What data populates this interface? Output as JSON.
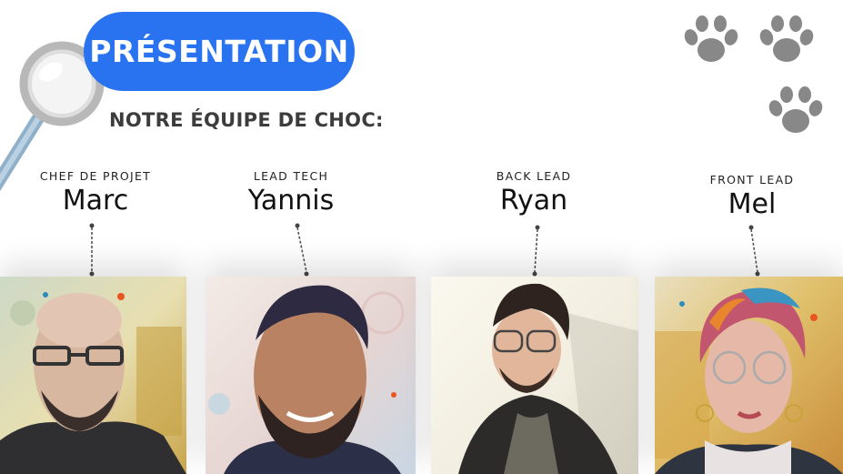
{
  "slide": {
    "title": "PRÉSENTATION",
    "subtitle": "NOTRE ÉQUIPE DE CHOC:"
  },
  "team": [
    {
      "role": "CHEF DE PROJET",
      "name": "Marc"
    },
    {
      "role": "LEAD TECH",
      "name": "Yannis"
    },
    {
      "role": "BACK LEAD",
      "name": "Ryan"
    },
    {
      "role": "FRONT LEAD",
      "name": "Mel"
    }
  ],
  "colors": {
    "accent": "#2a73f0",
    "paw": "#888888",
    "text_dark": "#3c3c3c"
  },
  "icons": [
    "magnifier-icon",
    "paw-icon"
  ]
}
